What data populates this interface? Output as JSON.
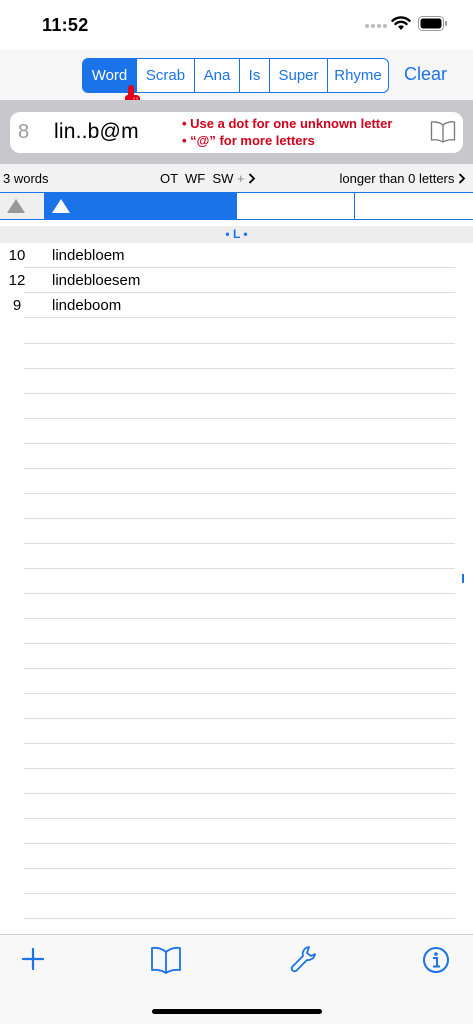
{
  "status": {
    "time": "11:52"
  },
  "toolbar": {
    "modes": [
      {
        "label": "Word",
        "active": true
      },
      {
        "label": "Scrab",
        "active": false
      },
      {
        "label": "Ana",
        "active": false
      },
      {
        "label": "Is",
        "active": false
      },
      {
        "label": "Super",
        "active": false
      },
      {
        "label": "Rhyme",
        "active": false
      }
    ],
    "clear_label": "Clear"
  },
  "search": {
    "length": "8",
    "query": "lin..b@m",
    "hint_dot": "• Use a dot for one unknown letter",
    "hint_at": "• “@” for more letters"
  },
  "info": {
    "word_count": "3 words",
    "dictionaries": "OT  WF  SW",
    "plus": "+",
    "length_filter": "longer than 0 letters"
  },
  "section": {
    "label": "• L •"
  },
  "words": [
    {
      "length": "10",
      "word": "lindebloem"
    },
    {
      "length": "12",
      "word": "lindebloesem"
    },
    {
      "length": "9",
      "word": "lindeboom"
    }
  ],
  "colors": {
    "accent": "#1a73e8",
    "hint": "#d0021b"
  },
  "tabbar": {
    "icons": [
      "add-icon",
      "book-icon",
      "wrench-icon",
      "info-icon"
    ]
  }
}
